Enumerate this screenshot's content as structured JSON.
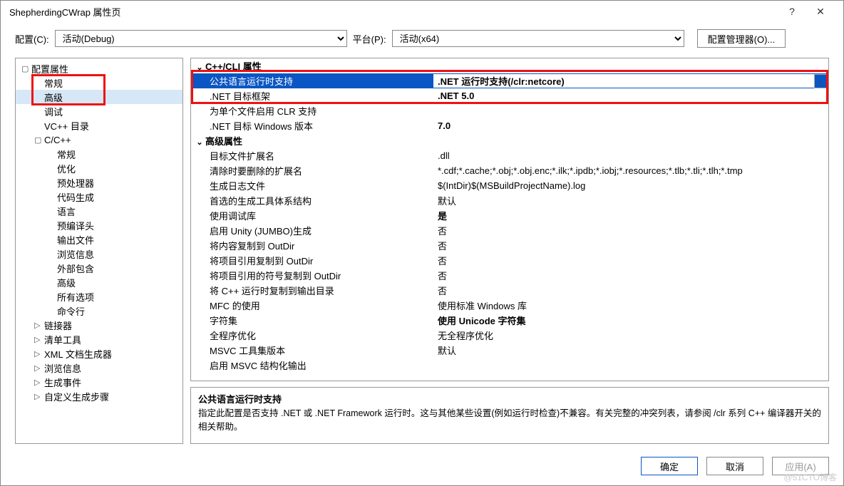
{
  "window": {
    "title": "ShepherdingCWrap 属性页",
    "help": "?",
    "close": "✕"
  },
  "toolbar": {
    "config_label": "配置(C):",
    "config_value": "活动(Debug)",
    "platform_label": "平台(P):",
    "platform_value": "活动(x64)",
    "config_mgr": "配置管理器(O)..."
  },
  "tree": [
    {
      "d": 0,
      "exp": "▢",
      "label": "配置属性"
    },
    {
      "d": 1,
      "label": "常规"
    },
    {
      "d": 1,
      "label": "高级",
      "sel": true
    },
    {
      "d": 1,
      "label": "调试"
    },
    {
      "d": 1,
      "label": "VC++ 目录"
    },
    {
      "d": 1,
      "exp": "▢",
      "label": "C/C++"
    },
    {
      "d": 2,
      "label": "常规"
    },
    {
      "d": 2,
      "label": "优化"
    },
    {
      "d": 2,
      "label": "预处理器"
    },
    {
      "d": 2,
      "label": "代码生成"
    },
    {
      "d": 2,
      "label": "语言"
    },
    {
      "d": 2,
      "label": "预编译头"
    },
    {
      "d": 2,
      "label": "输出文件"
    },
    {
      "d": 2,
      "label": "浏览信息"
    },
    {
      "d": 2,
      "label": "外部包含"
    },
    {
      "d": 2,
      "label": "高级"
    },
    {
      "d": 2,
      "label": "所有选项"
    },
    {
      "d": 2,
      "label": "命令行"
    },
    {
      "d": 1,
      "exp": "▷",
      "label": "链接器"
    },
    {
      "d": 1,
      "exp": "▷",
      "label": "清单工具"
    },
    {
      "d": 1,
      "exp": "▷",
      "label": "XML 文档生成器"
    },
    {
      "d": 1,
      "exp": "▷",
      "label": "浏览信息"
    },
    {
      "d": 1,
      "exp": "▷",
      "label": "生成事件"
    },
    {
      "d": 1,
      "exp": "▷",
      "label": "自定义生成步骤"
    }
  ],
  "grid": [
    {
      "group": true,
      "name": "C++/CLI 属性"
    },
    {
      "name": "公共语言运行时支持",
      "val": ".NET 运行时支持(/clr:netcore)",
      "sel": true,
      "bold": true,
      "dd": true
    },
    {
      "name": ".NET 目标框架",
      "val": ".NET 5.0",
      "bold": true
    },
    {
      "name": "为单个文件启用 CLR 支持",
      "val": ""
    },
    {
      "name": ".NET 目标 Windows 版本",
      "val": "7.0",
      "bold": true
    },
    {
      "group": true,
      "name": "高级属性"
    },
    {
      "name": "目标文件扩展名",
      "val": ".dll"
    },
    {
      "name": "清除时要删除的扩展名",
      "val": "*.cdf;*.cache;*.obj;*.obj.enc;*.ilk;*.ipdb;*.iobj;*.resources;*.tlb;*.tli;*.tlh;*.tmp"
    },
    {
      "name": "生成日志文件",
      "val": "$(IntDir)$(MSBuildProjectName).log"
    },
    {
      "name": "首选的生成工具体系结构",
      "val": "默认"
    },
    {
      "name": "使用调试库",
      "val": "是",
      "bold": true
    },
    {
      "name": "启用 Unity (JUMBO)生成",
      "val": "否"
    },
    {
      "name": "将内容复制到 OutDir",
      "val": "否"
    },
    {
      "name": "将项目引用复制到 OutDir",
      "val": "否"
    },
    {
      "name": "将项目引用的符号复制到 OutDir",
      "val": "否"
    },
    {
      "name": "将 C++ 运行时复制到输出目录",
      "val": "否"
    },
    {
      "name": "MFC 的使用",
      "val": "使用标准 Windows 库"
    },
    {
      "name": "字符集",
      "val": "使用 Unicode 字符集",
      "bold": true
    },
    {
      "name": "全程序优化",
      "val": "无全程序优化"
    },
    {
      "name": "MSVC 工具集版本",
      "val": "默认"
    },
    {
      "name": "启用 MSVC 结构化输出",
      "val": ""
    }
  ],
  "desc": {
    "title": "公共语言运行时支持",
    "text": "指定此配置是否支持 .NET 或 .NET Framework 运行时。这与其他某些设置(例如运行时检查)不兼容。有关完整的冲突列表，请参阅 /clr 系列 C++ 编译器开关的相关帮助。"
  },
  "footer": {
    "ok": "确定",
    "cancel": "取消",
    "apply": "应用(A)"
  },
  "watermark": "@51CTO博客"
}
